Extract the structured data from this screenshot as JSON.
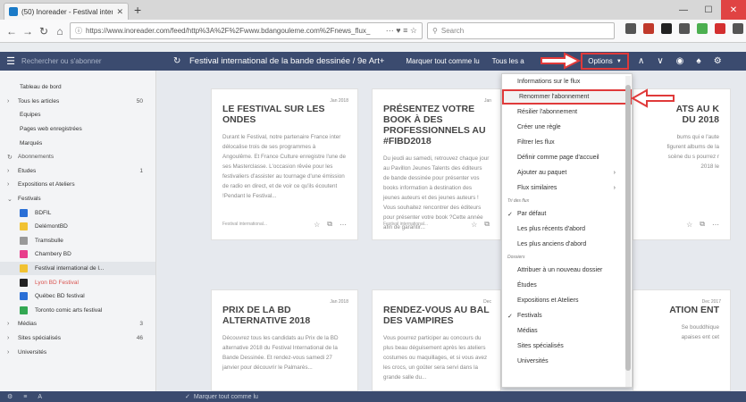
{
  "browser": {
    "tab_title": "(50) Inoreader - Festival internat...",
    "url": "https://www.inoreader.com/feed/http%3A%2F%2Fwww.bdangouleme.com%2Fnews_flux_",
    "url_more": "⋯",
    "search_placeholder": "Search",
    "ext_colors": [
      "#555555",
      "#c0392b",
      "#222222",
      "#555555",
      "#4caf50",
      "#d32f2f",
      "#555555"
    ]
  },
  "app": {
    "search_placeholder": "Rechercher ou s'abonner",
    "feed_title": "Festival international de la bande dessinée / 9e Art+",
    "mark_all": "Marquer tout comme lu",
    "all_items": "Tous les a",
    "options": "Options",
    "bottom_text": "Marquer tout comme lu"
  },
  "sidebar": {
    "items": [
      {
        "label": "Tableau de bord",
        "count": "",
        "type": "top"
      },
      {
        "label": "Tous les articles",
        "count": "50",
        "type": "arrow"
      },
      {
        "label": "Équipes",
        "count": "",
        "type": "top"
      },
      {
        "label": "Pages web enregistrées",
        "count": "",
        "type": "top"
      },
      {
        "label": "Marqués",
        "count": "",
        "type": "top"
      },
      {
        "label": "Abonnements",
        "count": "",
        "type": "head"
      },
      {
        "label": "Études",
        "count": "1",
        "type": "arrow"
      },
      {
        "label": "Expositions et Ateliers",
        "count": "",
        "type": "arrow"
      },
      {
        "label": "Festivals",
        "count": "",
        "type": "open"
      },
      {
        "label": "BDFIL",
        "count": "",
        "type": "sub",
        "color": "#2a6fd6"
      },
      {
        "label": "DelémontBD",
        "count": "",
        "type": "sub",
        "color": "#f1c232"
      },
      {
        "label": "Tramsbulle",
        "count": "",
        "type": "sub",
        "color": "#999999"
      },
      {
        "label": "Chambery BD",
        "count": "",
        "type": "sub",
        "color": "#e83e8c"
      },
      {
        "label": "Festival international de l...",
        "count": "",
        "type": "sub",
        "color": "#f1c232",
        "selected": true
      },
      {
        "label": "Lyon BD Festival",
        "count": "",
        "type": "sub",
        "color": "#222222",
        "red": true
      },
      {
        "label": "Québec BD festival",
        "count": "",
        "type": "sub",
        "color": "#2a6fd6"
      },
      {
        "label": "Toronto comic arts festival",
        "count": "",
        "type": "sub",
        "color": "#34a853"
      },
      {
        "label": "Médias",
        "count": "3",
        "type": "arrow"
      },
      {
        "label": "Sites spécialisés",
        "count": "46",
        "type": "arrow"
      },
      {
        "label": "Universités",
        "count": "",
        "type": "arrow"
      }
    ]
  },
  "cards": [
    {
      "date": "Jan 2018",
      "title": "Le Festival sur les ondes",
      "body": "Durant le Festival, notre partenaire France inter délocalise trois de ses programmes à Angoulême. Et France Culture enregistre l'une de ses Masterclasse. L'occasion rêvée pour les festivaliers d'assister au tournage d'une émission de radio en direct, et de voir ce qu'ils écoutent !Pendant le Festival...",
      "source": "Festival international..."
    },
    {
      "date": "Jan",
      "title": "Présentez votre book à des professionnels au #FIBD2018",
      "body": "Du jeudi au samedi, retrouvez chaque jour au Pavillon Jeunes Talents des éditeurs de bande dessinée pour présenter vos books information à destination des jeunes auteurs et des jeunes auteurs ! Vous souhaitez rencontrer des éditeurs pour présenter votre book ?Cette année afin de garantir...",
      "source": "Festival international..."
    },
    {
      "date": "Jan 2018",
      "title": "Prix de la BD alternative 2018",
      "body": "Découvrez tous les candidats au Prix de la BD alternative 2018 du Festival International de la Bande Dessinée. Et rendez-vous samedi 27 janvier pour découvrir le Palmarès...",
      "source": ""
    },
    {
      "date": "Dec",
      "title": "Rendez-vous au bal des vampires",
      "body": "Vous pourrez participer au concours du plus beau déguisement après les ateliers costumes ou maquillages, et si vous avez les crocs, un goûter sera servi dans la grande salle du...",
      "source": ""
    },
    {
      "date": "",
      "title": "ATS AU K DU 2018",
      "body": "bums qui e l'aute figurent albums de la scène du s pourrez r 2018 le",
      "source": ""
    },
    {
      "date": "Dec 2017",
      "title": "ATION ENT",
      "body": "Se bouddhique apaises ent cet",
      "source": ""
    }
  ],
  "menu": {
    "items": [
      {
        "label": "Informations sur le flux",
        "kind": "item"
      },
      {
        "label": "Renommer l'abonnement",
        "kind": "item",
        "highlight": true
      },
      {
        "label": "Résilier l'abonnement",
        "kind": "item"
      },
      {
        "label": "Créer une règle",
        "kind": "item"
      },
      {
        "label": "Filtrer les flux",
        "kind": "item"
      },
      {
        "label": "Définir comme page d'accueil",
        "kind": "item"
      },
      {
        "label": "Ajouter au paquet",
        "kind": "item",
        "submenu": true
      },
      {
        "label": "Flux similaires",
        "kind": "item",
        "submenu": true
      },
      {
        "label": "Tri des flux",
        "kind": "section"
      },
      {
        "label": "Par défaut",
        "kind": "item",
        "checked": true
      },
      {
        "label": "Les plus récents d'abord",
        "kind": "item"
      },
      {
        "label": "Les plus anciens d'abord",
        "kind": "item"
      },
      {
        "label": "Dossiers",
        "kind": "section"
      },
      {
        "label": "Attribuer à un nouveau dossier",
        "kind": "item"
      },
      {
        "label": "Études",
        "kind": "item"
      },
      {
        "label": "Expositions et Ateliers",
        "kind": "item"
      },
      {
        "label": "Festivals",
        "kind": "item",
        "checked": true
      },
      {
        "label": "Médias",
        "kind": "item"
      },
      {
        "label": "Sites spécialisés",
        "kind": "item"
      },
      {
        "label": "Universités",
        "kind": "item"
      }
    ]
  },
  "colors": {
    "app_bar": "#3b4b6f",
    "annotation": "#e03a3a"
  }
}
